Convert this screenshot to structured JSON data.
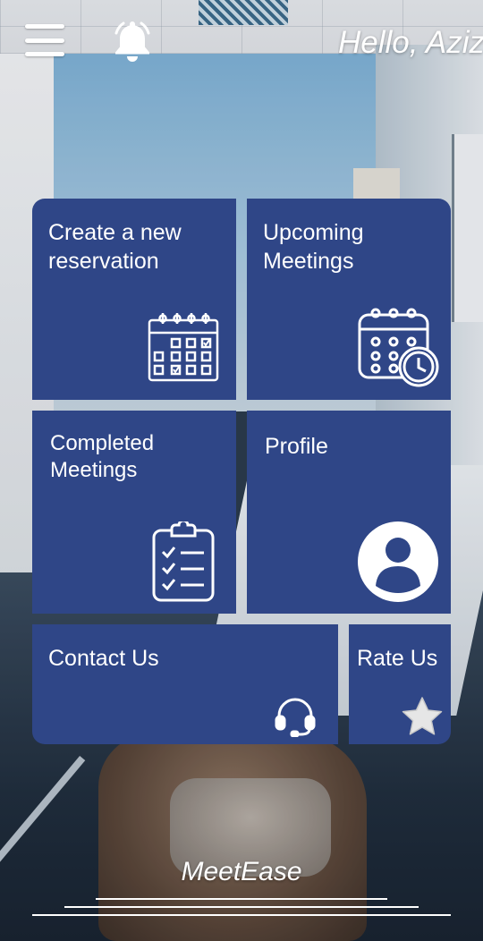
{
  "header": {
    "menu_icon": "hamburger-menu-icon",
    "bell_icon": "bell-icon",
    "greeting": "Hello, Aziz"
  },
  "tiles": [
    {
      "id": "create",
      "label_line1": "Create a new",
      "label_line2": "reservation",
      "icon": "calendar-grid-icon"
    },
    {
      "id": "upcoming",
      "label_line1": "Upcoming",
      "label_line2": "Meetings",
      "icon": "calendar-clock-icon"
    },
    {
      "id": "completed",
      "label_line1": "Completed",
      "label_line2": "Meetings",
      "icon": "clipboard-checklist-icon"
    },
    {
      "id": "profile",
      "label_line1": "Profile",
      "label_line2": "",
      "icon": "user-avatar-icon"
    },
    {
      "id": "contact",
      "label_line1": "Contact Us",
      "label_line2": "",
      "icon": "headset-icon"
    },
    {
      "id": "rate",
      "label_line1": "Rate Us",
      "label_line2": "",
      "icon": "star-icon"
    }
  ],
  "footer": {
    "brand": "MeetEase"
  },
  "colors": {
    "tile_bg": "#2f4687",
    "text": "#ffffff"
  }
}
